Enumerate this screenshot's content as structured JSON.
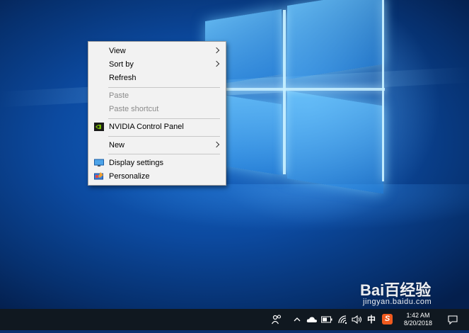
{
  "context_menu": {
    "items": [
      {
        "label": "View",
        "submenu": true,
        "enabled": true
      },
      {
        "label": "Sort by",
        "submenu": true,
        "enabled": true
      },
      {
        "label": "Refresh",
        "submenu": false,
        "enabled": true
      },
      {
        "label": "Paste",
        "submenu": false,
        "enabled": false
      },
      {
        "label": "Paste shortcut",
        "submenu": false,
        "enabled": false
      },
      {
        "label": "NVIDIA Control Panel",
        "submenu": false,
        "enabled": true,
        "icon": "nvidia-icon"
      },
      {
        "label": "New",
        "submenu": true,
        "enabled": true
      },
      {
        "label": "Display settings",
        "submenu": false,
        "enabled": true,
        "icon": "display-icon"
      },
      {
        "label": "Personalize",
        "submenu": false,
        "enabled": true,
        "icon": "personalize-icon"
      }
    ]
  },
  "taskbar": {
    "ime_label": "中",
    "sogou_label": "S",
    "time": "1:42 AM",
    "date": "8/20/2018",
    "background": "#101820"
  },
  "watermark": {
    "brand": "Bai百经验",
    "url": "jingyan.baidu.com"
  },
  "colors": {
    "menu_bg": "#f2f2f2",
    "disabled_text": "#8a8a8a",
    "nvidia_green": "#76b900",
    "sogou_orange": "#f05a1e"
  }
}
